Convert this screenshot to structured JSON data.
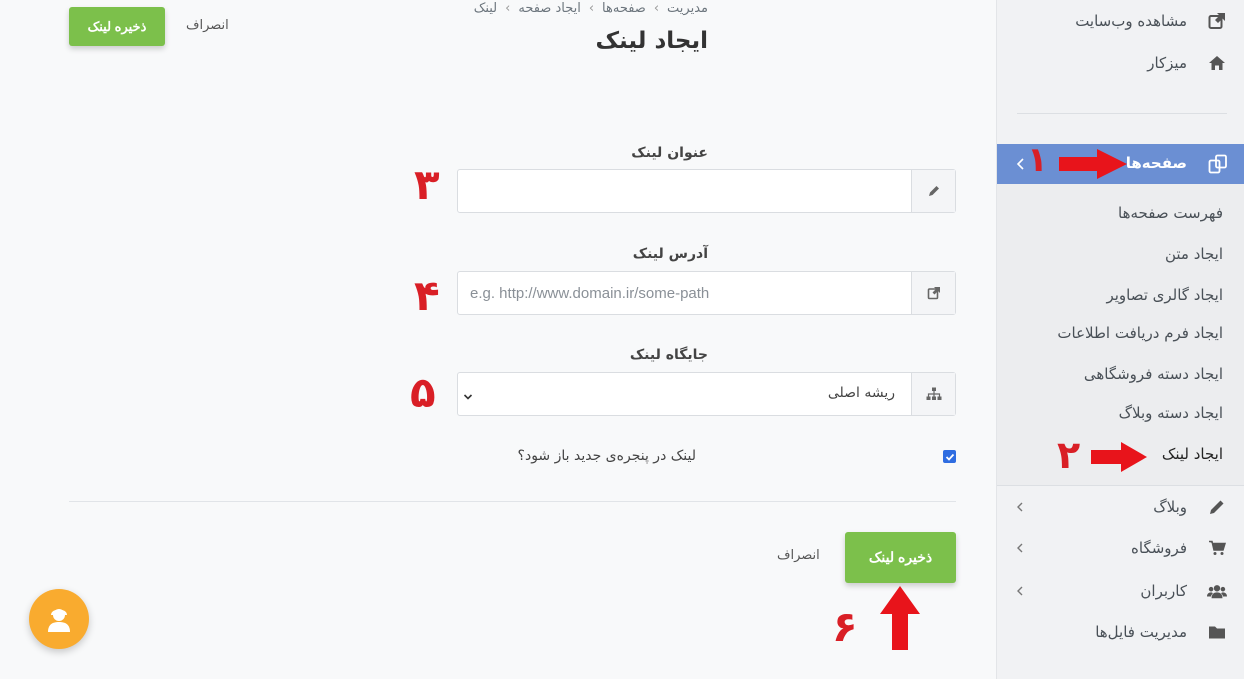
{
  "header": {
    "breadcrumbs": [
      "مدیریت",
      "صفحه‌ها",
      "ایجاد صفحه",
      "لینک"
    ],
    "title": "ایجاد لینک",
    "save_label": "ذخیره لینک",
    "cancel_label": "انصراف"
  },
  "form": {
    "title_label": "عنوان لینک",
    "title_value": "",
    "url_label": "آدرس لینک",
    "url_placeholder": "e.g. http://www.domain.ir/some-path",
    "position_label": "جایگاه لینک",
    "position_value": "ریشه اصلی",
    "new_window_label": "لینک در پنجره‌ی جدید باز شود؟",
    "new_window_checked": true,
    "save_label": "ذخیره لینک",
    "cancel_label": "انصراف"
  },
  "sidebar": {
    "top_items": [
      {
        "label": "مشاهده وب‌سایت",
        "icon": "external-link-icon"
      },
      {
        "label": "میزکار",
        "icon": "home-icon"
      }
    ],
    "active_item": {
      "label": "صفحه‌ها",
      "icon": "pages-icon"
    },
    "sub_items": [
      "فهرست صفحه‌ها",
      "ایجاد متن",
      "ایجاد گالری تصاویر",
      "ایجاد فرم دریافت اطلاعات",
      "ایجاد دسته فروشگاهی",
      "ایجاد دسته وبلاگ",
      "ایجاد لینک"
    ],
    "bottom_items": [
      {
        "label": "وبلاگ",
        "icon": "pencil-icon"
      },
      {
        "label": "فروشگاه",
        "icon": "cart-icon"
      },
      {
        "label": "کاربران",
        "icon": "users-icon"
      },
      {
        "label": "مدیریت فایل‌ها",
        "icon": "folder-icon"
      }
    ]
  },
  "annotations": [
    "۱",
    "۲",
    "۳",
    "۴",
    "۵",
    "۶"
  ],
  "colors": {
    "accent_green": "#7cc04b",
    "sidebar_active": "#6b8fd3",
    "annotation_red": "#d91f26",
    "fab_orange": "#f9ab2f"
  }
}
